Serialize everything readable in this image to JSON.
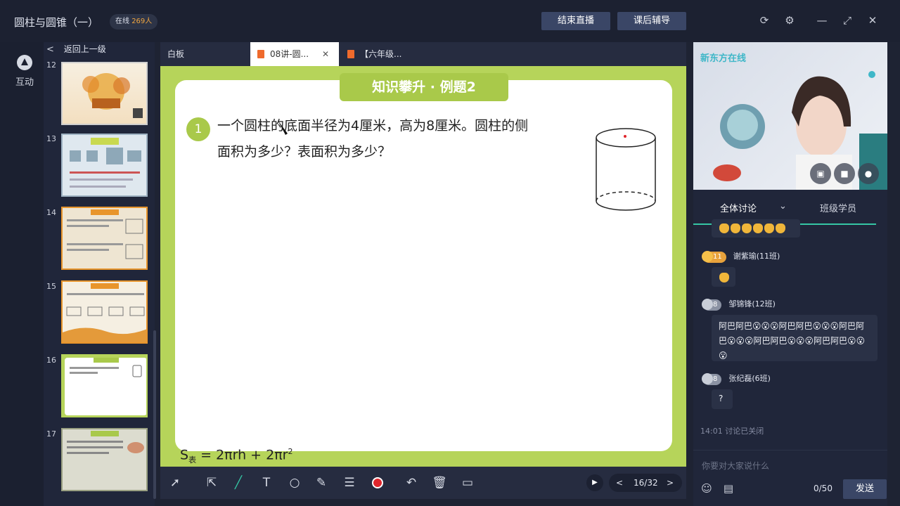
{
  "window": {
    "title": "圆柱与圆锥（一）",
    "online_label": "在线",
    "online_count": "269人",
    "end_live_button": "结束直播",
    "after_class_button": "课后辅导"
  },
  "rail": {
    "interact_label": "互动"
  },
  "slides_panel": {
    "back_label": "返回上一级",
    "thumbnails": [
      {
        "num": "12"
      },
      {
        "num": "13"
      },
      {
        "num": "14"
      },
      {
        "num": "15"
      },
      {
        "num": "16"
      },
      {
        "num": "17"
      }
    ]
  },
  "tabs": [
    {
      "label": "白板"
    },
    {
      "label": "08讲-圆..."
    },
    {
      "label": "【六年级..."
    }
  ],
  "board": {
    "banner": "知识攀升 · 例题2",
    "question_number": "1",
    "question_line1": "一个圆柱的底面半径为4厘米，高为8厘米。圆柱的侧",
    "question_line2": "面积为多少？表面积为多少？",
    "formula_s": "S",
    "formula_sub": "表",
    "formula_rest": " = 2πrh + 2πr",
    "formula_sup": "2"
  },
  "pager": {
    "page": "16/32",
    "prev": "<",
    "next": ">"
  },
  "video": {
    "brand": "新东方在线"
  },
  "chat": {
    "tab_all": "全体讨论",
    "tab_students": "班级学员",
    "messages": [
      {
        "level": "11",
        "user": "谢紫瑜(11班)"
      },
      {
        "level": "8",
        "user": "邹锦锋(12班)",
        "text": "阿巴阿巴😮😮😮阿巴阿巴😮😮😮阿巴阿巴😮😮😮阿巴阿巴😮😮😮阿巴阿巴😮😮😮"
      },
      {
        "level": "8",
        "user": "张纪磊(6班)",
        "text": "?"
      }
    ],
    "status_note": "14:01 讨论已关闭",
    "placeholder": "你要对大家说什么",
    "char_count": "0/50",
    "send_label": "发送"
  },
  "colors": {
    "board_green": "#b6d45a",
    "accent_teal": "#35c6a4",
    "button_blue": "#3a4666",
    "record_red": "#e0262c"
  }
}
